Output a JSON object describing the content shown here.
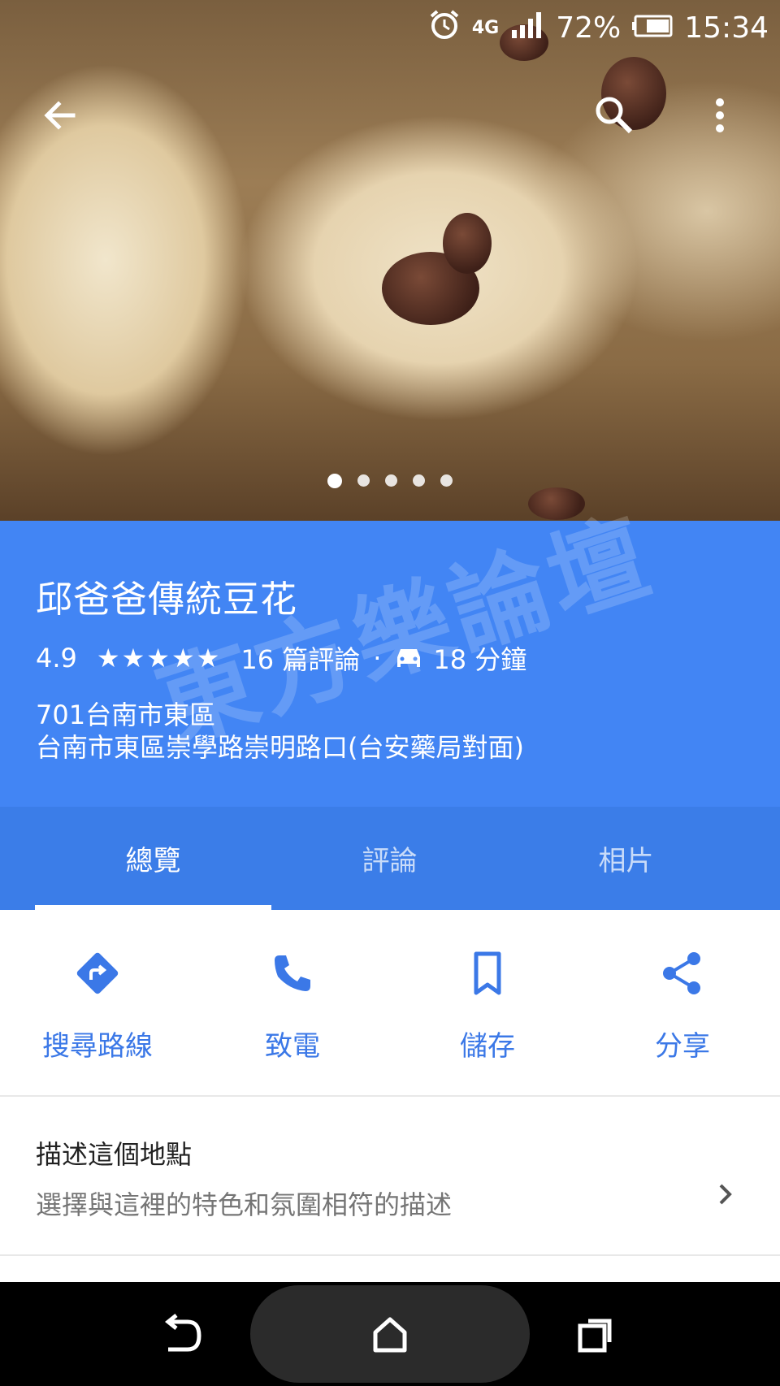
{
  "status_bar": {
    "network": "4G",
    "battery": "72%",
    "time": "15:34",
    "icons": [
      "alarm-icon",
      "signal-icon",
      "battery-icon"
    ]
  },
  "top_bar": {
    "icons": [
      "back-arrow-icon",
      "search-icon",
      "more-vert-icon"
    ]
  },
  "gallery": {
    "photo_count": 5,
    "active_index": 0
  },
  "place": {
    "name": "邱爸爸傳統豆花",
    "rating": "4.9",
    "stars": "★★★★★",
    "reviews": "16 篇評論",
    "separator": "·",
    "drive_time": "18 分鐘",
    "postal_line": "701台南市東區",
    "address_line": "台南市東區崇學路崇明路口(台安藥局對面)"
  },
  "watermark": "東方樂論壇",
  "tabs": [
    {
      "label": "總覽",
      "active": true
    },
    {
      "label": "評論",
      "active": false
    },
    {
      "label": "相片",
      "active": false
    }
  ],
  "actions": [
    {
      "label": "搜尋路線",
      "icon": "directions-icon"
    },
    {
      "label": "致電",
      "icon": "phone-icon"
    },
    {
      "label": "儲存",
      "icon": "bookmark-icon"
    },
    {
      "label": "分享",
      "icon": "share-icon"
    }
  ],
  "describe": {
    "title": "描述這個地點",
    "subtitle": "選擇與這裡的特色和氛圍相符的描述"
  },
  "colors": {
    "accent": "#4285f4",
    "tabs_bg": "#3b7de8",
    "action_text": "#3b78e7"
  }
}
